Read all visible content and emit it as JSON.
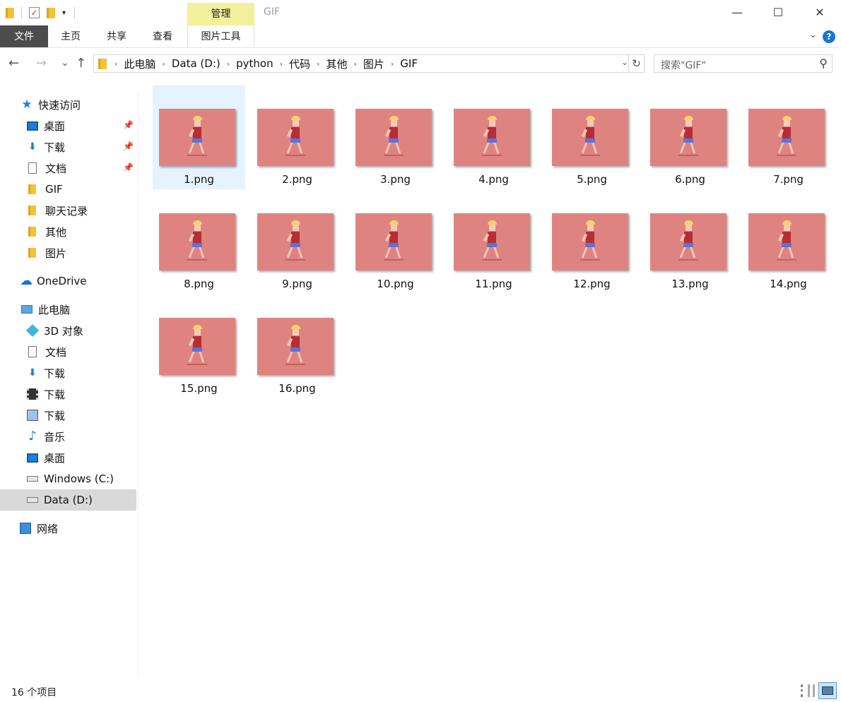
{
  "window": {
    "title": "GIF",
    "context_tab": "管理",
    "minimize": "—",
    "maximize": "☐",
    "close": "✕"
  },
  "ribbon": {
    "tabs": [
      "文件",
      "主页",
      "共享",
      "查看",
      "图片工具"
    ],
    "expand_icon": "chevron-down-icon",
    "help": "?"
  },
  "address": {
    "back": "←",
    "forward": "→",
    "recent": "⌄",
    "up": "↑",
    "path": [
      "此电脑",
      "Data (D:)",
      "python",
      "代码",
      "其他",
      "图片",
      "GIF"
    ],
    "separator": "›",
    "dropdown": "⌄",
    "refresh": "↻"
  },
  "search": {
    "placeholder": "搜索\"GIF\"",
    "icon": "⚲"
  },
  "sidebar": {
    "quick_access": "快速访问",
    "pinned": [
      "桌面",
      "下载",
      "文档"
    ],
    "folders": [
      "GIF",
      "聊天记录",
      "其他",
      "图片"
    ],
    "onedrive": "OneDrive",
    "this_pc": "此电脑",
    "pc_items": [
      "3D 对象",
      "文档",
      "下载",
      "下载",
      "下载",
      "音乐",
      "桌面",
      "Windows (C:)",
      "Data (D:)"
    ],
    "network": "网络",
    "selected": "Data (D:)"
  },
  "files": [
    "1.png",
    "2.png",
    "3.png",
    "4.png",
    "5.png",
    "6.png",
    "7.png",
    "8.png",
    "9.png",
    "10.png",
    "11.png",
    "12.png",
    "13.png",
    "14.png",
    "15.png",
    "16.png"
  ],
  "selected_file": "1.png",
  "thumbnail_color": "#df8381",
  "status": {
    "count": "16 个项目"
  }
}
